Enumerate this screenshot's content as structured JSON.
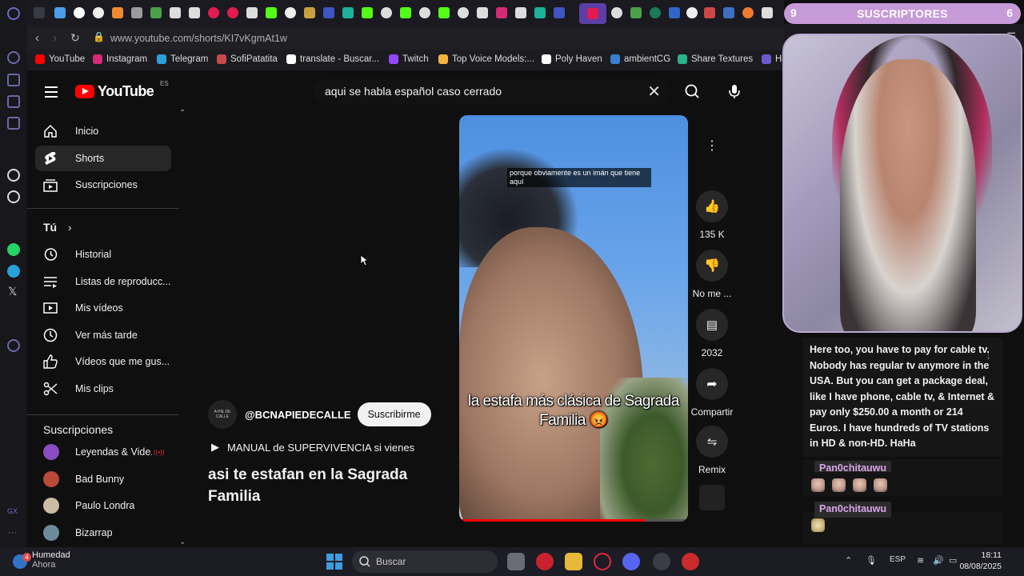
{
  "browser": {
    "url": "www.youtube.com/shorts/KI7vKgmAt1w",
    "bookmarks": [
      {
        "label": "YouTube",
        "color": "#ff0000"
      },
      {
        "label": "Instagram",
        "color": "#d62976"
      },
      {
        "label": "Telegram",
        "color": "#2aa1da"
      },
      {
        "label": "SofiPatatita",
        "color": "#c64a4a"
      },
      {
        "label": "translate - Buscar...",
        "color": "#ffffff"
      },
      {
        "label": "Twitch",
        "color": "#9146ff"
      },
      {
        "label": "Top Voice Models:...",
        "color": "#f2b33d"
      },
      {
        "label": "Poly Haven",
        "color": "#ffffff"
      },
      {
        "label": "ambientCG",
        "color": "#3a7fd1"
      },
      {
        "label": "Share Textures",
        "color": "#2ab38a"
      },
      {
        "label": "Ha",
        "color": "#6a5acd"
      }
    ]
  },
  "youtube": {
    "logo_text": "YouTube",
    "country_code": "ES",
    "search_value": "aqui se habla español caso cerrado",
    "guide": {
      "main": [
        {
          "label": "Inicio",
          "icon": "home-icon"
        },
        {
          "label": "Shorts",
          "icon": "shorts-icon"
        },
        {
          "label": "Suscripciones",
          "icon": "subscriptions-icon"
        }
      ],
      "you_heading": "Tú",
      "you": [
        {
          "label": "Historial",
          "icon": "history-icon"
        },
        {
          "label": "Listas de reproducc...",
          "icon": "playlists-icon"
        },
        {
          "label": "Mis vídeos",
          "icon": "your-videos-icon"
        },
        {
          "label": "Ver más tarde",
          "icon": "watch-later-icon"
        },
        {
          "label": "Vídeos que me gus...",
          "icon": "liked-icon"
        },
        {
          "label": "Mis clips",
          "icon": "clips-icon"
        }
      ],
      "subs_heading": "Suscripciones",
      "subs": [
        {
          "label": "Leyendas & Vide...",
          "color": "#8a4cc2",
          "live": "((•))"
        },
        {
          "label": "Bad Bunny",
          "color": "#b84a3a"
        },
        {
          "label": "Paulo Londra",
          "color": "#cbbba5"
        },
        {
          "label": "Bizarrap",
          "color": "#6c8a9a"
        }
      ]
    },
    "short": {
      "caption_top": "porque obviamente es un imán que tiene aquí",
      "caption_main": "la estafa más clásica de Sagrada Familia 😡",
      "progress": 0.81,
      "channel": "@BCNAPIEDECALLE",
      "channel_avatar_text": "A PIE DE CALLE",
      "subscribe_label": "Suscribirme",
      "music": "MANUAL de SUPERVIVENCIA si vienes",
      "title": "asi te estafan en la Sagrada Familia",
      "actions": {
        "likes": "135 K",
        "dislike": "No me ...",
        "comments": "2032",
        "share": "Compartir",
        "remix": "Remix"
      }
    }
  },
  "overlay": {
    "subs_left": "9",
    "subs_title": "SUSCRIPTORES",
    "subs_right": "6",
    "chat": {
      "message": "Here too, you have to pay for cable tv. Nobody has regular tv anymore in the USA. But you can get a package deal, like I have phone, cable tv, & Internet & pay only $250.00 a month or 214 Euros. I have hundreds of TV stations in HD & non-HD. HaHa",
      "user1": "Pan0chitauwu",
      "user2": "Pan0chitauwu"
    }
  },
  "taskbar": {
    "weather_title": "Humedad",
    "weather_sub": "Ahora",
    "weather_badge": "4",
    "search_placeholder": "Buscar",
    "lang": "ESP",
    "time": "18:11",
    "date": "08/08/2025"
  }
}
